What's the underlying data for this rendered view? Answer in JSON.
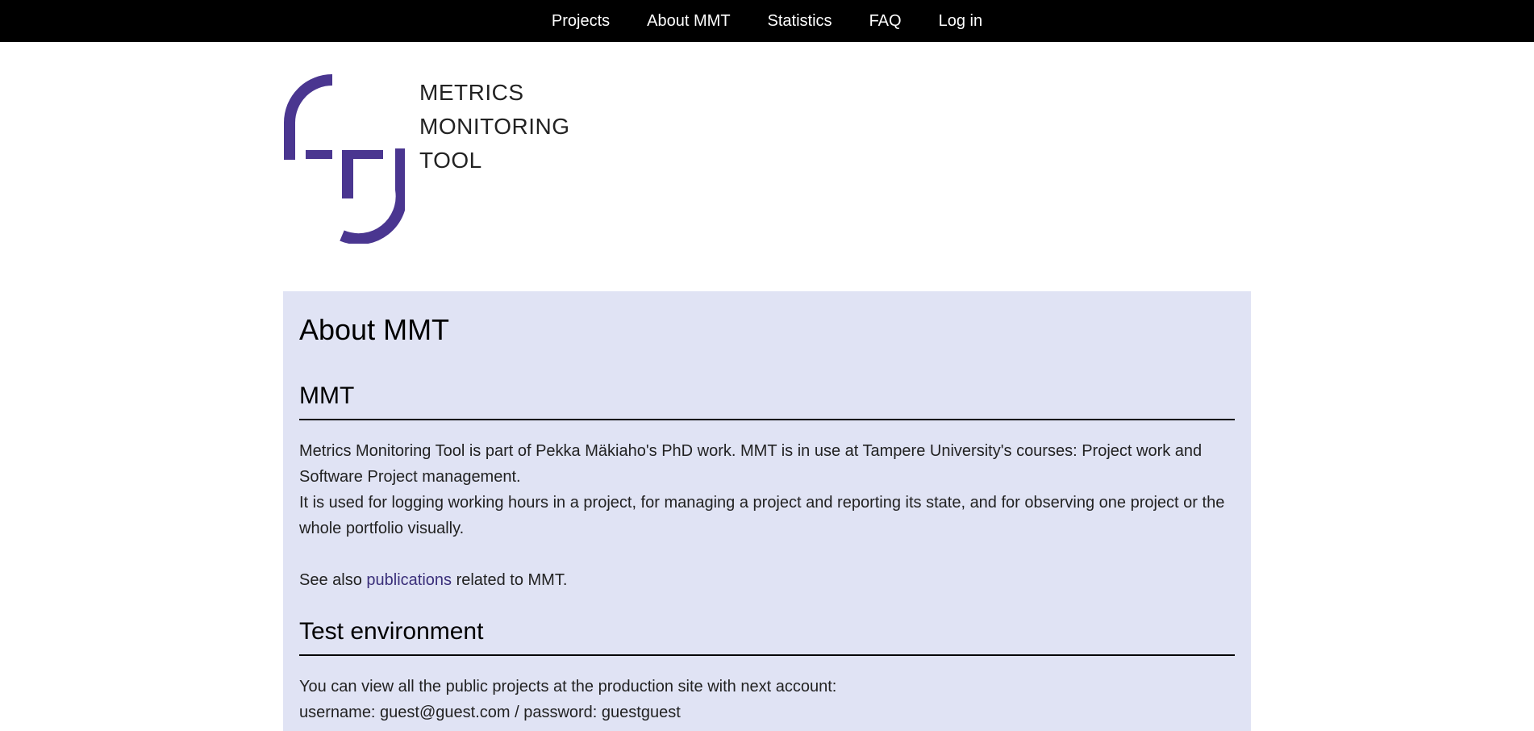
{
  "nav": {
    "items": [
      {
        "label": "Projects"
      },
      {
        "label": "About MMT"
      },
      {
        "label": "Statistics"
      },
      {
        "label": "FAQ"
      },
      {
        "label": "Log in"
      }
    ]
  },
  "logo": {
    "lines": [
      "METRICS",
      "MONITORING",
      "TOOL"
    ],
    "color": "#4a3690"
  },
  "page": {
    "title": "About MMT"
  },
  "sections": {
    "mmt": {
      "heading": "MMT",
      "para1": "Metrics Monitoring Tool is part of Pekka Mäkiaho's PhD work. MMT is in use at Tampere University's courses: Project work and Software Project management.",
      "para2": "It is used for logging working hours in a project, for managing a project and reporting its state, and for observing one project or the whole portfolio visually.",
      "see_also_prefix": "See also ",
      "see_also_link": "publications",
      "see_also_suffix": " related to MMT."
    },
    "test": {
      "heading": "Test environment",
      "line1": "You can view all the public projects at the production site with next account:",
      "line2": "username: guest@guest.com / password: guestguest"
    }
  },
  "colors": {
    "nav_bg": "#000000",
    "content_bg": "#e0e3f4",
    "link": "#3a2f7a"
  }
}
